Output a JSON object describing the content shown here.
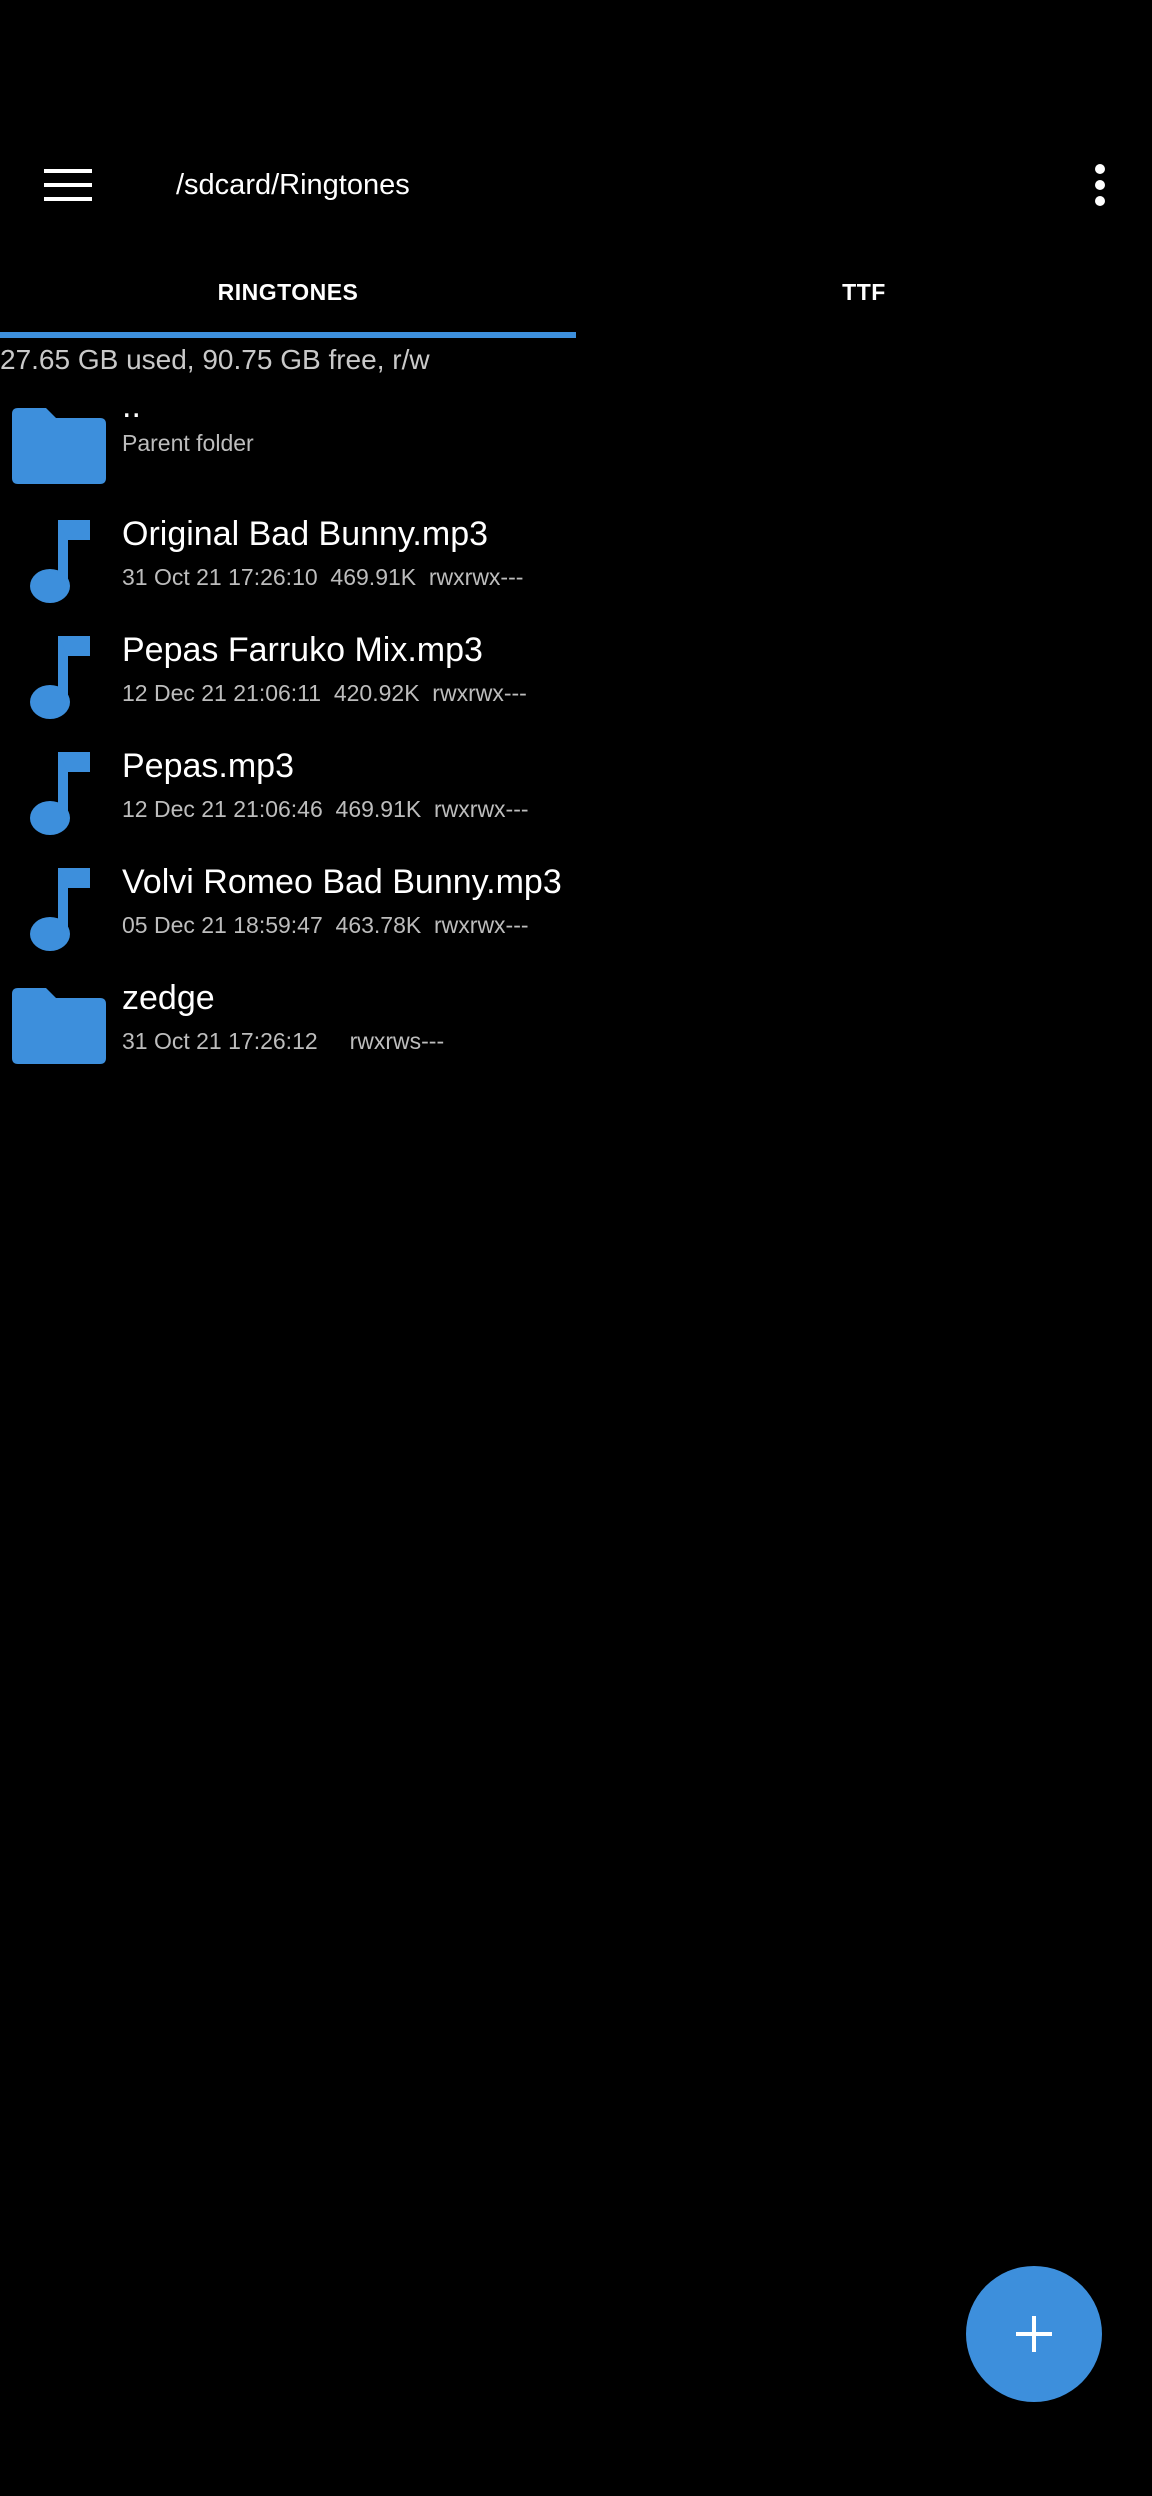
{
  "toolbar": {
    "menu_icon": "hamburger-menu-icon",
    "path": "/sdcard/Ringtones",
    "overflow_icon": "more-vert-icon"
  },
  "tabs": [
    {
      "label": "RINGTONES",
      "active": true
    },
    {
      "label": "TTF",
      "active": false
    }
  ],
  "storage_info": "27.65 GB used, 90.75 GB free, r/w",
  "files": [
    {
      "type": "folder",
      "name": "..",
      "meta": "Parent folder"
    },
    {
      "type": "audio",
      "name": "Original Bad Bunny.mp3",
      "meta": "31 Oct 21 17:26:10  469.91K  rwxrwx---"
    },
    {
      "type": "audio",
      "name": "Pepas Farruko Mix.mp3",
      "meta": "12 Dec 21 21:06:11  420.92K  rwxrwx---"
    },
    {
      "type": "audio",
      "name": "Pepas.mp3",
      "meta": "12 Dec 21 21:06:46  469.91K  rwxrwx---"
    },
    {
      "type": "audio",
      "name": "Volvi Romeo Bad Bunny.mp3",
      "meta": "05 Dec 21 18:59:47  463.78K  rwxrwx---"
    },
    {
      "type": "folder",
      "name": "zedge",
      "meta": "31 Oct 21 17:26:12     rwxrws---"
    }
  ],
  "fab": {
    "icon": "plus-icon"
  },
  "colors": {
    "accent": "#3d8fdc",
    "background": "#000000",
    "secondary_text": "#bdbdbd"
  }
}
